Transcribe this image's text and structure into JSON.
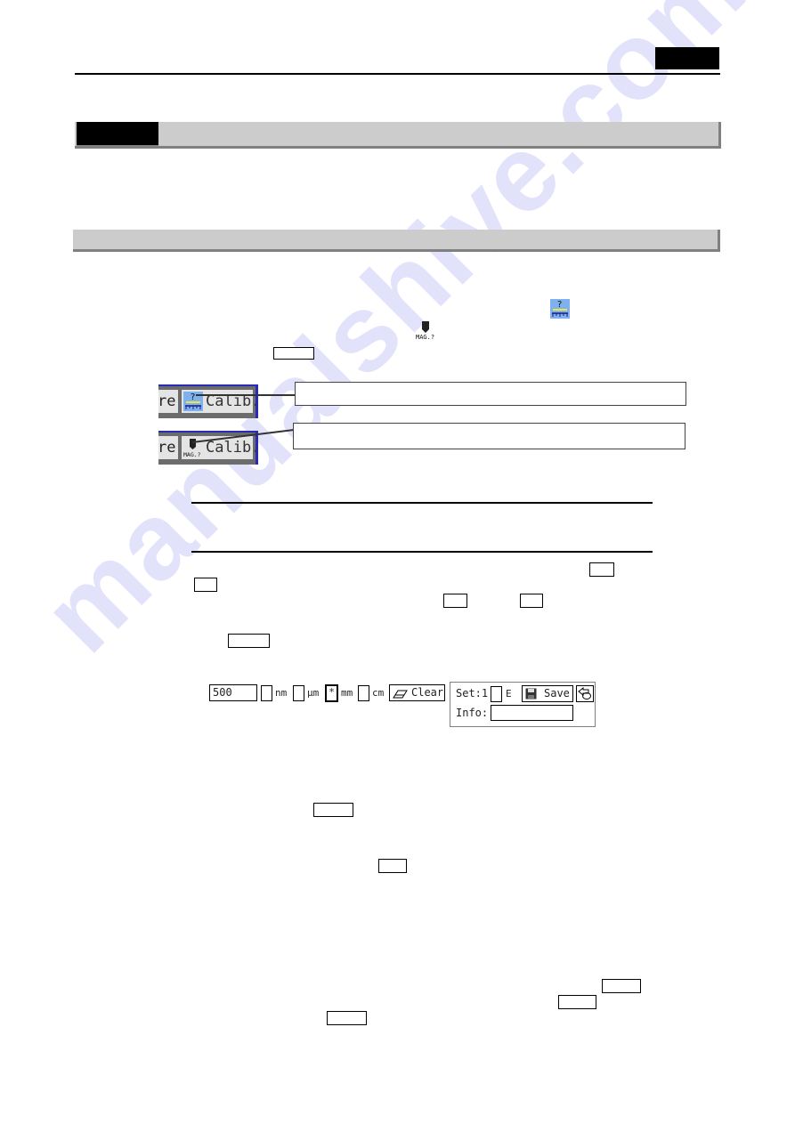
{
  "header": {
    "page_tag_text": "",
    "rule": true
  },
  "section": {
    "number": "",
    "title": "",
    "body_text": ""
  },
  "subsection": {
    "title": "",
    "intro_text": ""
  },
  "icons": {
    "calibration_icon": "ruler-question-icon",
    "magnification_icon": "mag-question-icon",
    "colors": {
      "calib_icon_bg": "#7fb1ef",
      "toolbar_border": "#2a2ab8",
      "section_bar": "#cccccc",
      "section_shadow": "#808080",
      "watermark": "#9696f0"
    }
  },
  "toolbar_shots": [
    {
      "prev_label": "re",
      "button_label": "Calib.",
      "icon": "ruler-question-icon",
      "callout": ""
    },
    {
      "prev_label": "re",
      "button_label": "Calib.",
      "icon": "mag-question-icon",
      "callout": "",
      "icon_caption": "MAG.?"
    }
  ],
  "inline_keys": {
    "key1": "",
    "key2": "",
    "key3": "",
    "key4": "",
    "key5": "",
    "key6": "",
    "key7": "",
    "key8": "",
    "key9": "",
    "key10": "",
    "key11": ""
  },
  "note": {
    "text": ""
  },
  "measurement_widget": {
    "length_value": "500",
    "units": [
      {
        "label": "nm",
        "checked": false
      },
      {
        "label": "µm",
        "checked": false
      },
      {
        "label": "mm",
        "checked": true,
        "mark": "*"
      },
      {
        "label": "cm",
        "checked": false
      }
    ],
    "clear_label": "Clear",
    "set_label": "Set:1",
    "e_label": "E",
    "e_checked": false,
    "save_label": "Save",
    "info_label": "Info:",
    "info_value": ""
  },
  "watermark": "manualshive.com"
}
